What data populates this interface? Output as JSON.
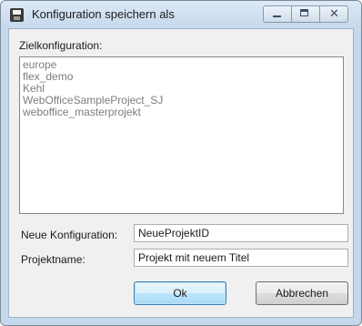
{
  "window": {
    "title": "Konfiguration speichern als",
    "icon": "save-icon"
  },
  "title_controls": {
    "minimize_icon": "minimize-icon",
    "maximize_icon": "maximize-icon",
    "close_icon": "close-icon",
    "close_glyph": "✕"
  },
  "target_section": {
    "label": "Zielkonfiguration:",
    "items": [
      "europe",
      "flex_demo",
      "Kehl",
      "WebOfficeSampleProject_SJ",
      "weboffice_masterprojekt"
    ]
  },
  "form": {
    "new_config_label": "Neue Konfiguration:",
    "new_config_value": "NeueProjektID",
    "project_name_label": "Projektname:",
    "project_name_value": "Projekt mit neuem Titel"
  },
  "buttons": {
    "ok_label": "Ok",
    "cancel_label": "Abbrechen"
  },
  "colors": {
    "titlebar": "#c6d8eb",
    "client_background": "#f0f0f0",
    "default_button_border": "#3c7fb1"
  }
}
